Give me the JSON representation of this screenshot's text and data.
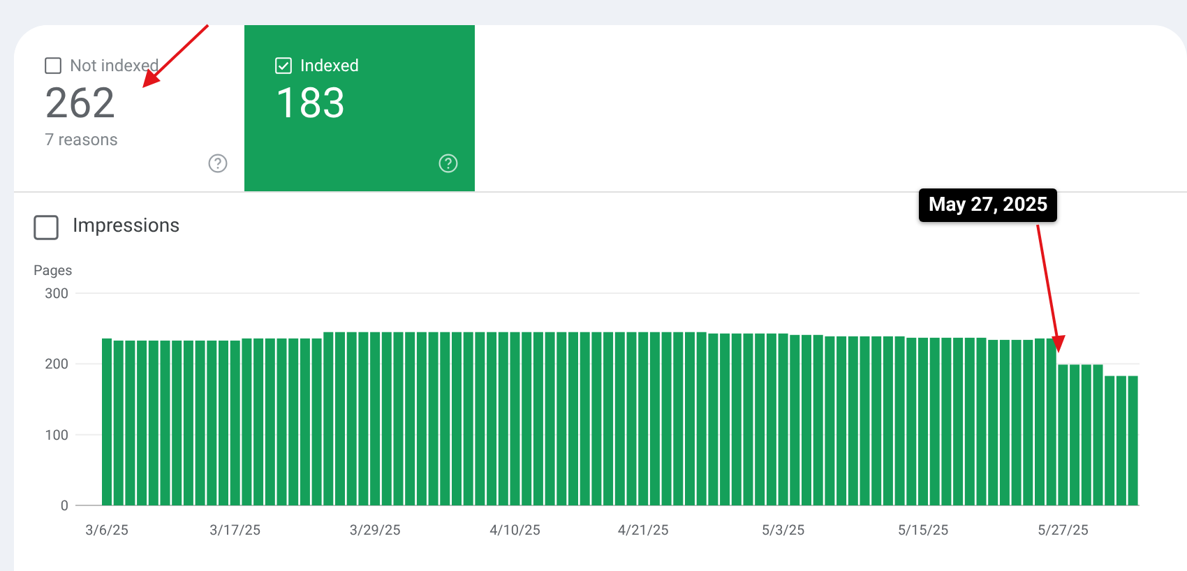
{
  "cards": [
    {
      "label": "Not indexed",
      "selected": false,
      "value": "262",
      "subtitle": "7 reasons"
    },
    {
      "label": "Indexed",
      "selected": true,
      "value": "183"
    }
  ],
  "impressions": {
    "label": "Impressions",
    "checked": false
  },
  "chart": {
    "chart_data": {
      "type": "bar",
      "ylabel": "Pages",
      "categories": [
        "3/6/25",
        null,
        null,
        null,
        null,
        null,
        null,
        null,
        null,
        null,
        null,
        "3/17/25",
        null,
        null,
        null,
        null,
        null,
        null,
        null,
        null,
        null,
        null,
        null,
        "3/29/25",
        null,
        null,
        null,
        null,
        null,
        null,
        null,
        null,
        null,
        null,
        null,
        "4/10/25",
        null,
        null,
        null,
        null,
        null,
        null,
        null,
        null,
        null,
        null,
        "4/21/25",
        null,
        null,
        null,
        null,
        null,
        null,
        null,
        null,
        null,
        null,
        null,
        "5/3/25",
        null,
        null,
        null,
        null,
        null,
        null,
        null,
        null,
        null,
        null,
        null,
        "5/15/25",
        null,
        null,
        null,
        null,
        null,
        null,
        null,
        null,
        null,
        null,
        null,
        "5/27/25",
        null,
        null,
        null,
        null,
        null,
        null
      ],
      "series": [
        {
          "color": "#15a05a",
          "values": [
            236,
            233,
            233,
            233,
            233,
            233,
            233,
            233,
            233,
            233,
            233,
            233,
            236,
            236,
            236,
            236,
            236,
            236,
            236,
            245,
            245,
            245,
            245,
            245,
            245,
            245,
            245,
            245,
            245,
            245,
            245,
            245,
            245,
            245,
            245,
            245,
            245,
            245,
            245,
            245,
            245,
            245,
            245,
            245,
            245,
            245,
            245,
            245,
            245,
            245,
            245,
            245,
            243,
            243,
            243,
            243,
            243,
            243,
            243,
            241,
            241,
            241,
            239,
            239,
            239,
            239,
            239,
            239,
            239,
            237,
            237,
            237,
            237,
            237,
            237,
            237,
            234,
            234,
            234,
            234,
            236,
            236,
            199,
            199,
            199,
            199,
            183,
            183,
            183
          ]
        }
      ],
      "ylim": [
        0,
        300
      ],
      "yticks": [
        0,
        100,
        200,
        300
      ],
      "annotations": [
        "May 27, 2025"
      ]
    }
  }
}
